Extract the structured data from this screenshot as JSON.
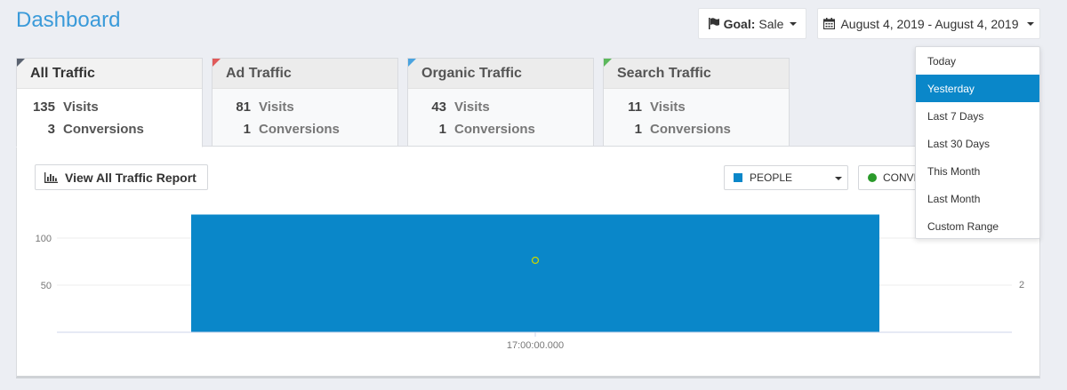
{
  "header": {
    "title": "Dashboard",
    "goal_label": "Goal:",
    "goal_value": "Sale",
    "date_range": "August 4, 2019 - August 4, 2019"
  },
  "tabs": [
    {
      "label": "All Traffic",
      "visits": "135",
      "visits_label": "Visits",
      "conversions": "3",
      "conversions_label": "Conversions",
      "accent": "#5a6270"
    },
    {
      "label": "Ad Traffic",
      "visits": "81",
      "visits_label": "Visits",
      "conversions": "1",
      "conversions_label": "Conversions",
      "accent": "#e05a5a"
    },
    {
      "label": "Organic Traffic",
      "visits": "43",
      "visits_label": "Visits",
      "conversions": "1",
      "conversions_label": "Conversions",
      "accent": "#4aa3df"
    },
    {
      "label": "Search Traffic",
      "visits": "11",
      "visits_label": "Visits",
      "conversions": "1",
      "conversions_label": "Conversions",
      "accent": "#5cb85c"
    }
  ],
  "controls": {
    "report_button": "View All Traffic Report",
    "people_select": "PEOPLE",
    "conversions_select": "CONVERSIONS"
  },
  "date_dropdown": {
    "options": [
      "Today",
      "Yesterday",
      "Last 7 Days",
      "Last 30 Days",
      "This Month",
      "Last Month",
      "Custom Range"
    ],
    "selected": "Yesterday"
  },
  "chart_data": {
    "type": "bar",
    "categories": [
      "17:00:00.000"
    ],
    "series": [
      {
        "name": "PEOPLE",
        "values": [
          125
        ],
        "color": "#0a87c9"
      },
      {
        "name": "CONVERSIONS",
        "values": [
          3
        ],
        "color": "#c8d400"
      }
    ],
    "y_left_ticks": [
      "100",
      "50"
    ],
    "y_right_ticks": [
      "2"
    ],
    "ylim": [
      0,
      125
    ],
    "y2lim": [
      0,
      4
    ],
    "grid": true
  },
  "colors": {
    "accent": "#3a9ad9",
    "selected": "#0a87c9"
  }
}
